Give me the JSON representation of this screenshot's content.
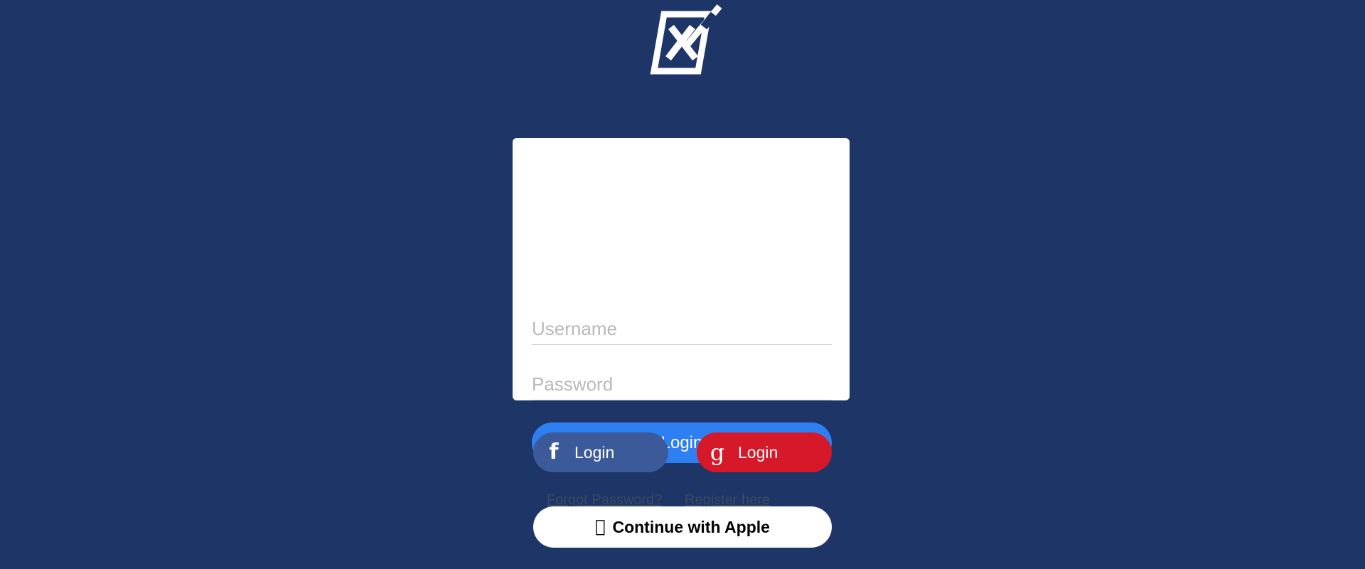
{
  "theme": {
    "background": "#1d3567",
    "card_background": "#ffffff",
    "primary_button": "#2e80f2",
    "facebook_blue": "#3c5a99",
    "google_red": "#d51929",
    "apple_white": "#ffffff",
    "link_color": "#3c4a63",
    "placeholder_color": "#b9b9b9"
  },
  "logo": {
    "name": "x-checkbox-logo",
    "description": "Skewed square outline with an X inside and a diagonal slash through the top-right corner",
    "color": "#ffffff"
  },
  "form": {
    "username": {
      "placeholder": "Username",
      "value": ""
    },
    "password": {
      "placeholder": "Password",
      "value": ""
    },
    "submit_label": "Login"
  },
  "links": {
    "forgot_password": "Forgot Password?",
    "register": "Register here"
  },
  "social": {
    "facebook": {
      "icon": "facebook-f-icon",
      "glyph": "f",
      "label": "Login"
    },
    "google": {
      "icon": "google-g-icon",
      "glyph": "g",
      "label": "Login"
    },
    "apple": {
      "icon": "apple-icon",
      "glyph": "",
      "label": "Continue with Apple"
    }
  }
}
